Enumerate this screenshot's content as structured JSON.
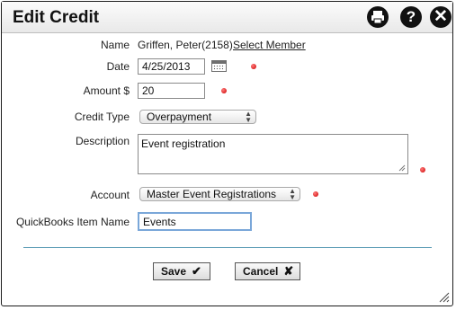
{
  "window": {
    "title": "Edit Credit",
    "icons": {
      "print": "printer-icon",
      "help": "?",
      "close": "✕"
    }
  },
  "form": {
    "name": {
      "label": "Name",
      "value": "Griffen, Peter(2158)",
      "link": "Select Member"
    },
    "date": {
      "label": "Date",
      "value": "4/25/2013"
    },
    "amount": {
      "label": "Amount $",
      "value": "20"
    },
    "credit_type": {
      "label": "Credit Type",
      "value": "Overpayment"
    },
    "description": {
      "label": "Description",
      "value": "Event registration"
    },
    "account": {
      "label": "Account",
      "value": "Master Event Registrations"
    },
    "qb_item": {
      "label": "QuickBooks Item Name",
      "value": "Events"
    }
  },
  "buttons": {
    "save": {
      "label": "Save",
      "icon": "✔"
    },
    "cancel": {
      "label": "Cancel",
      "icon": "✘"
    }
  },
  "colors": {
    "required": "#cc0000",
    "focus": "#7aa7d9",
    "divider": "#5b9bb5"
  }
}
